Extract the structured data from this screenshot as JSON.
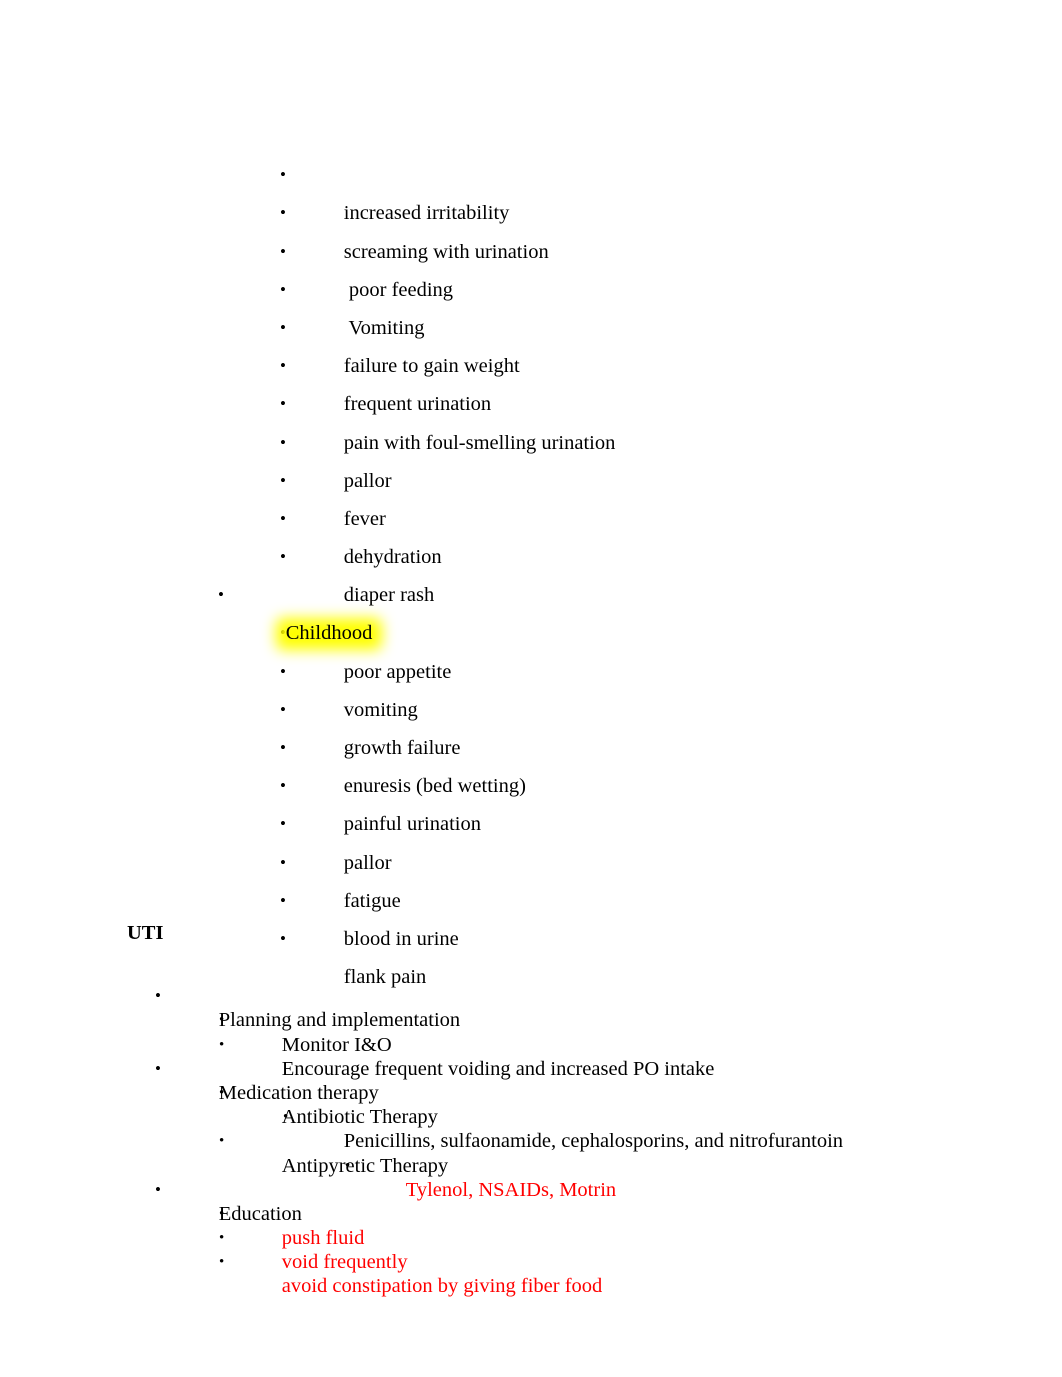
{
  "document": {
    "bullet_glyph": "•",
    "colors": {
      "text": "#000000",
      "accent_red": "#ff0000",
      "highlight_yellow": "#ffff00"
    }
  },
  "infant_symptoms": {
    "items": [
      {
        "text": "increased irritability"
      },
      {
        "text": "screaming with urination"
      },
      {
        "text": " poor feeding"
      },
      {
        "text": " Vomiting"
      },
      {
        "text": "failure to gain weight"
      },
      {
        "text": "frequent urination"
      },
      {
        "text": "pain with foul-smelling urination"
      },
      {
        "text": "pallor"
      },
      {
        "text": "fever"
      },
      {
        "text": "dehydration"
      },
      {
        "text": "diaper rash"
      }
    ]
  },
  "childhood": {
    "label": "Childhood",
    "highlighted": true,
    "items": [
      {
        "text": "poor appetite"
      },
      {
        "text": "vomiting"
      },
      {
        "text": "growth failure"
      },
      {
        "text": "enuresis (bed wetting)"
      },
      {
        "text": "painful urination"
      },
      {
        "text": "pallor"
      },
      {
        "text": "fatigue"
      },
      {
        "text": "blood in urine"
      },
      {
        "text": "flank pain"
      }
    ]
  },
  "uti_section": {
    "heading": "UTI",
    "planning": {
      "label": "Planning and implementation",
      "items": [
        {
          "text": "Monitor I&O"
        },
        {
          "text": "Encourage frequent voiding and increased PO intake"
        }
      ]
    },
    "medication": {
      "label": "Medication therapy",
      "antibiotic": {
        "label": "Antibiotic Therapy",
        "detail": "Penicillins, sulfaonamide, cephalosporins, and nitrofurantoin"
      },
      "antipyretic": {
        "label": "Antipyretic Therapy",
        "detail": "Tylenol, NSAIDs, Motrin"
      }
    },
    "education": {
      "label": "Education",
      "items": [
        {
          "text": "push fluid"
        },
        {
          "text": "void frequently"
        },
        {
          "text": "avoid constipation by giving fiber food"
        }
      ]
    }
  }
}
